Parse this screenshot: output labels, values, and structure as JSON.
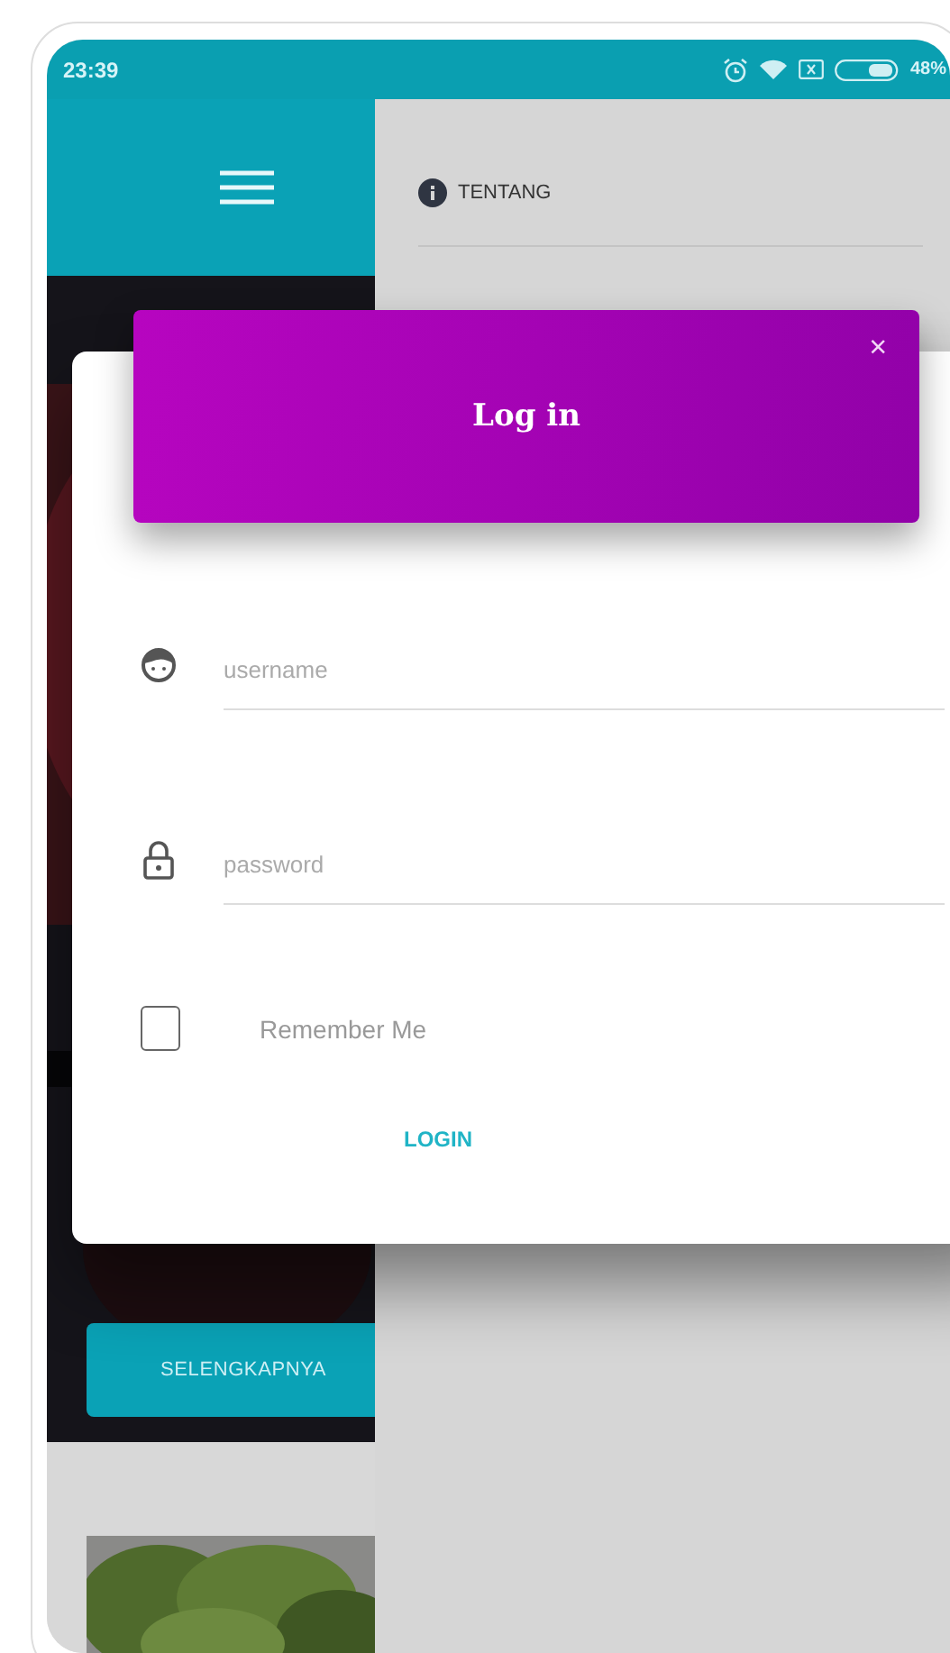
{
  "status_bar": {
    "time": "23:39",
    "battery": "48%"
  },
  "drawer": {
    "items": [
      {
        "label": "TENTANG"
      }
    ]
  },
  "hero": {
    "button": "SELENGKAPNYA"
  },
  "dialog": {
    "title": "Log in",
    "close": "×",
    "fields": [
      {
        "kind": "user",
        "placeholder": "username"
      },
      {
        "kind": "lock",
        "placeholder": "password"
      }
    ],
    "remember": {
      "label": "Remember Me",
      "checked": false
    },
    "submit": "LOGIN"
  }
}
